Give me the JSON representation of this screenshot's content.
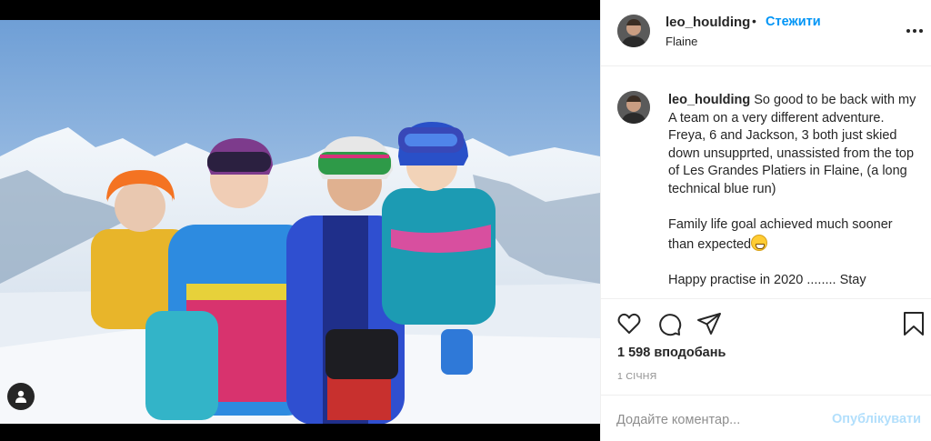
{
  "post": {
    "username": "leo_houlding",
    "separator": "•",
    "follow_label": "Стежити",
    "location": "Flaine",
    "caption_user": "leo_houlding",
    "caption_lines": [
      "So good to be back with my A team on a very different adventure.",
      "Freya, 6 and Jackson, 3 both just skied down unsupprted, unassisted from the top of Les Grandes Platiers in Flaine, (a long technical blue run)",
      "Family life goal achieved much sooner than expected"
    ],
    "caption_cut_line": "Happy practise in 2020 ........ Stay",
    "likes": "1 598 вподобань",
    "date": "1 СІЧНЯ"
  },
  "comment": {
    "placeholder": "Додайте коментар...",
    "post_label": "Опублікувати"
  },
  "icons": {
    "more": "more-options-icon",
    "like": "heart-icon",
    "comment": "comment-icon",
    "share": "share-icon",
    "save": "bookmark-icon",
    "tags": "user-tag-icon"
  },
  "colors": {
    "accent": "#0095f6",
    "post_disabled": "#b2dffc",
    "muted": "#8e8e8e"
  }
}
